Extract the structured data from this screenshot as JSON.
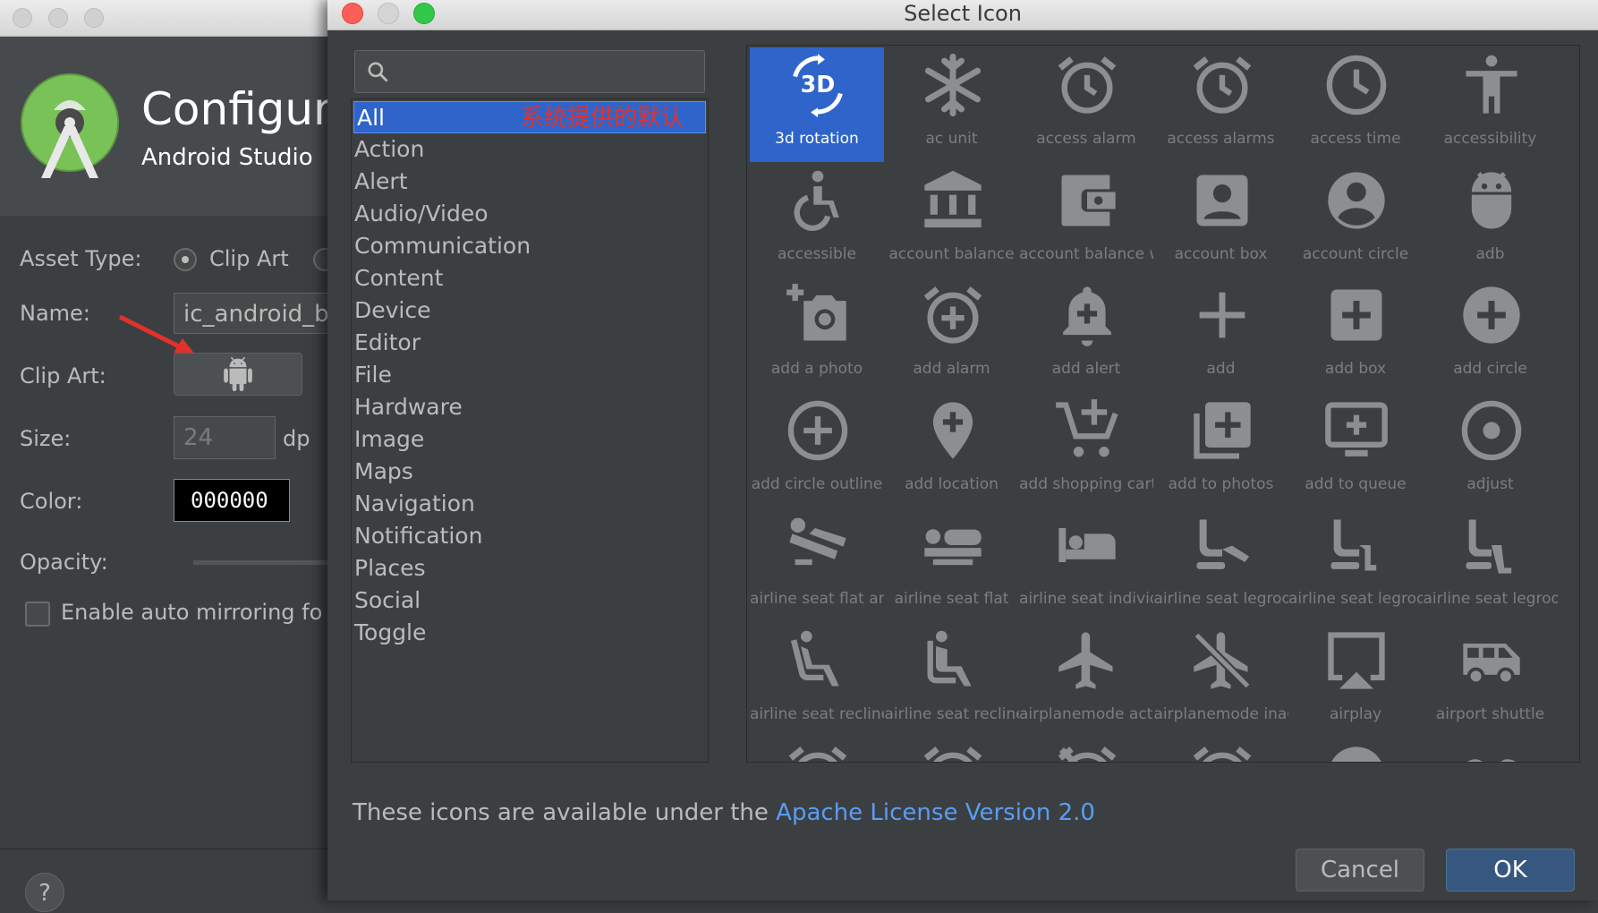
{
  "background_window": {
    "title": "Configure",
    "subtitle": "Android Studio",
    "asset_type_label": "Asset Type:",
    "asset_type_value": "Clip Art",
    "name_label": "Name:",
    "name_value": "ic_android_bl",
    "clip_art_label": "Clip Art:",
    "size_label": "Size:",
    "size_value": "24",
    "size_unit": "dp",
    "color_label": "Color:",
    "color_value": "000000",
    "opacity_label": "Opacity:",
    "mirroring_label": "Enable auto mirroring fo",
    "help_label": "?"
  },
  "dialog": {
    "title": "Select Icon",
    "search": {
      "placeholder": ""
    },
    "categories": [
      {
        "label": "All",
        "selected": true
      },
      {
        "label": "Action"
      },
      {
        "label": "Alert"
      },
      {
        "label": "Audio/Video"
      },
      {
        "label": "Communication"
      },
      {
        "label": "Content"
      },
      {
        "label": "Device"
      },
      {
        "label": "Editor"
      },
      {
        "label": "File"
      },
      {
        "label": "Hardware"
      },
      {
        "label": "Image"
      },
      {
        "label": "Maps"
      },
      {
        "label": "Navigation"
      },
      {
        "label": "Notification"
      },
      {
        "label": "Places"
      },
      {
        "label": "Social"
      },
      {
        "label": "Toggle"
      }
    ],
    "annotation": "系统提供的默认",
    "icons": [
      {
        "label": "3d rotation",
        "icon": "3d-rotation-icon",
        "selected": true
      },
      {
        "label": "ac unit",
        "icon": "ac-unit-icon"
      },
      {
        "label": "access alarm",
        "icon": "access-alarm-icon"
      },
      {
        "label": "access alarms",
        "icon": "access-alarms-icon"
      },
      {
        "label": "access time",
        "icon": "access-time-icon"
      },
      {
        "label": "accessibility",
        "icon": "accessibility-icon"
      },
      {
        "label": "accessible",
        "icon": "accessible-icon"
      },
      {
        "label": "account balance",
        "icon": "account-balance-icon"
      },
      {
        "label": "account balance w",
        "icon": "account-balance-wallet-icon"
      },
      {
        "label": "account box",
        "icon": "account-box-icon"
      },
      {
        "label": "account circle",
        "icon": "account-circle-icon"
      },
      {
        "label": "adb",
        "icon": "adb-icon"
      },
      {
        "label": "add a photo",
        "icon": "add-a-photo-icon"
      },
      {
        "label": "add alarm",
        "icon": "add-alarm-icon"
      },
      {
        "label": "add alert",
        "icon": "add-alert-icon"
      },
      {
        "label": "add",
        "icon": "add-icon"
      },
      {
        "label": "add box",
        "icon": "add-box-icon"
      },
      {
        "label": "add circle",
        "icon": "add-circle-icon"
      },
      {
        "label": "add circle outline",
        "icon": "add-circle-outline-icon"
      },
      {
        "label": "add location",
        "icon": "add-location-icon"
      },
      {
        "label": "add shopping cart",
        "icon": "add-shopping-cart-icon"
      },
      {
        "label": "add to photos",
        "icon": "add-to-photos-icon"
      },
      {
        "label": "add to queue",
        "icon": "add-to-queue-icon"
      },
      {
        "label": "adjust",
        "icon": "adjust-icon"
      },
      {
        "label": "airline seat flat an",
        "icon": "airline-seat-flat-angled-icon"
      },
      {
        "label": "airline seat flat",
        "icon": "airline-seat-flat-icon"
      },
      {
        "label": "airline seat individ",
        "icon": "airline-seat-individual-suite-icon"
      },
      {
        "label": "airline seat legroo",
        "icon": "airline-seat-legroom-extra-icon"
      },
      {
        "label": "airline seat legroo",
        "icon": "airline-seat-legroom-normal-icon"
      },
      {
        "label": "airline seat legroo",
        "icon": "airline-seat-legroom-reduced-icon"
      },
      {
        "label": "airline seat recline",
        "icon": "airline-seat-recline-extra-icon"
      },
      {
        "label": "airline seat recline",
        "icon": "airline-seat-recline-normal-icon"
      },
      {
        "label": "airplanemode acti",
        "icon": "airplanemode-active-icon"
      },
      {
        "label": "airplanemode inac",
        "icon": "airplanemode-inactive-icon"
      },
      {
        "label": "airplay",
        "icon": "airplay-icon"
      },
      {
        "label": "airport shuttle",
        "icon": "airport-shuttle-icon"
      }
    ],
    "partial_row_icons": [
      "alarm-icon",
      "alarm-add-icon",
      "alarm-off-icon",
      "alarm-on-icon",
      "album-icon",
      "all-inclusive-icon"
    ],
    "license_text": "These icons are available under the ",
    "license_link": "Apache License Version 2.0",
    "cancel_label": "Cancel",
    "ok_label": "OK"
  },
  "colors": {
    "selection": "#2f65ca",
    "link": "#589df6",
    "annotation": "#e2312b",
    "ok_button": "#365880"
  }
}
